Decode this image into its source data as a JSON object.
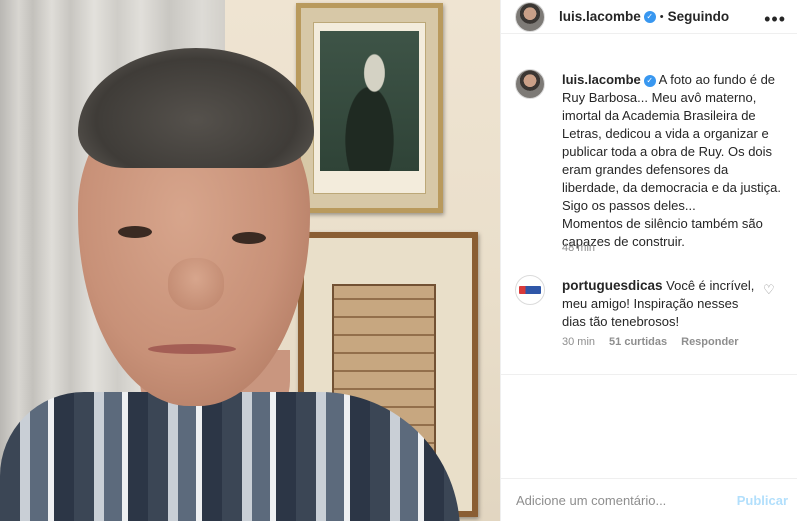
{
  "post": {
    "username": "luis.lacombe",
    "verified_icon": "verified-badge-icon",
    "separator": "•",
    "follow_status": "Seguindo",
    "more_icon": "more-options-icon",
    "more_glyph": "•••"
  },
  "caption": {
    "username": "luis.lacombe",
    "lines": [
      "A foto ao fundo é de",
      "Ruy Barbosa... Meu avô materno,",
      "imortal da Academia Brasileira de",
      "Letras, dedicou a vida a organizar e",
      "publicar toda a obra de Ruy. Os dois",
      "eram grandes defensores da",
      "liberdade, da democracia e da justiça.",
      "Sigo os passos deles...",
      "Momentos de silêncio também são",
      "capazes de construir."
    ],
    "time": "48 min"
  },
  "comment": {
    "username": "portuguesdicas",
    "lines": [
      "Você é incrível,",
      "meu amigo! Inspiração nesses",
      "dias tão tenebrosos!"
    ],
    "time": "30 min",
    "likes": "51 curtidas",
    "reply": "Responder",
    "like_icon": "heart-icon",
    "heart_glyph": "♡"
  },
  "add_comment": {
    "placeholder": "Adicione um comentário...",
    "publish": "Publicar"
  },
  "colors": {
    "link_blue": "#3897f0",
    "muted": "#8e8e8e",
    "publish_disabled": "#b2dffc"
  }
}
